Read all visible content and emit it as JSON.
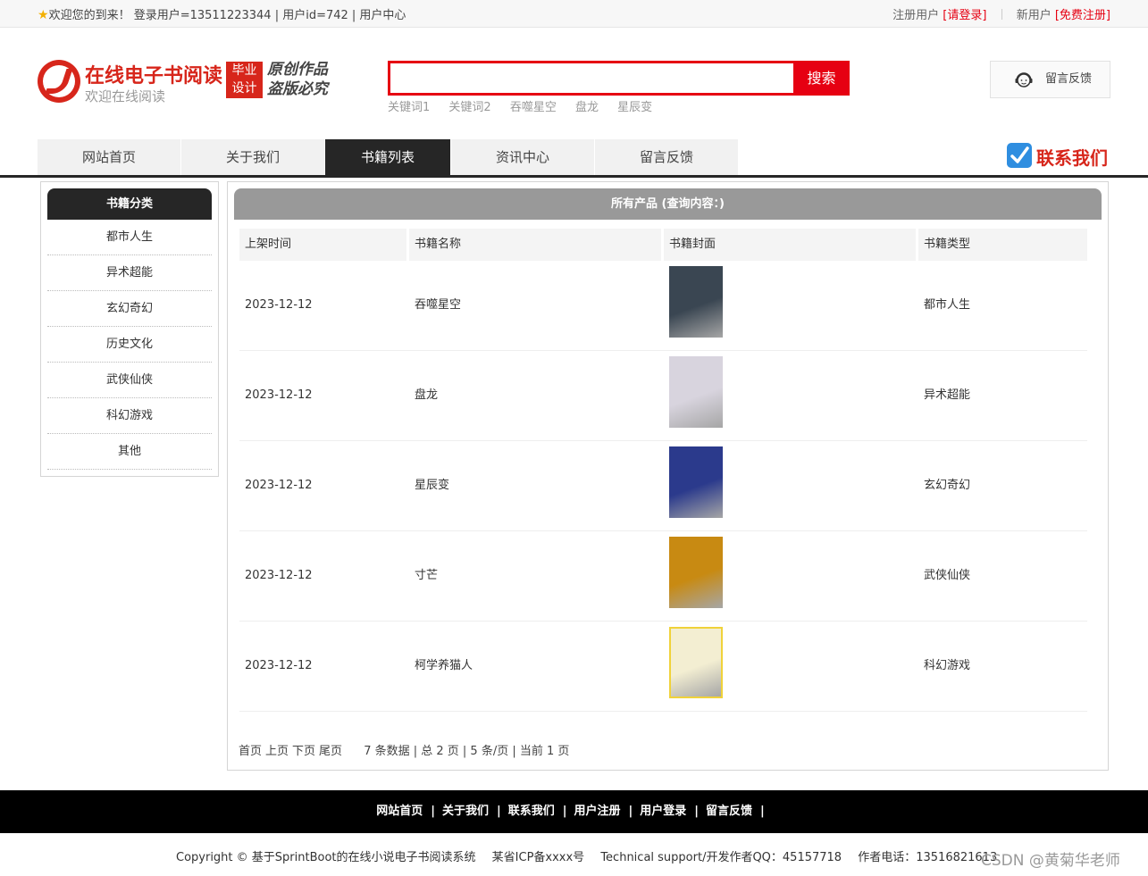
{
  "topbar": {
    "welcome": "欢迎您的到来！ 登录用户=13511223344 | 用户id=742 | 用户中心",
    "register_label": "注册用户",
    "login_link": "[请登录]",
    "newuser_label": "新用户",
    "free_register_link": "[免费注册]"
  },
  "header": {
    "title": "在线电子书阅读",
    "subtitle": "欢迎在线阅读",
    "grad_line1": "毕业",
    "grad_line2": "设计",
    "slogan_line1": "原创作品",
    "slogan_line2": "盗版必究",
    "search_button": "搜索",
    "search_value": "",
    "keywords": [
      "关键词1",
      "关键词2",
      "吞噬星空",
      "盘龙",
      "星辰变"
    ],
    "feedback_button": "留言反馈",
    "contact_label": "联系我们"
  },
  "nav": [
    "网站首页",
    "关于我们",
    "书籍列表",
    "资讯中心",
    "留言反馈"
  ],
  "nav_active": "书籍列表",
  "sidebar": {
    "title": "书籍分类",
    "categories": [
      "都市人生",
      "异术超能",
      "玄幻奇幻",
      "历史文化",
      "武侠仙侠",
      "科幻游戏",
      "其他"
    ]
  },
  "main": {
    "title": "所有产品 (查询内容：)",
    "columns": [
      "上架时间",
      "书籍名称",
      "书籍封面",
      "书籍类型"
    ],
    "rows": [
      {
        "date": "2023-12-12",
        "name": "吞噬星空",
        "type": "都市人生",
        "cover_color": "#3a4652"
      },
      {
        "date": "2023-12-12",
        "name": "盘龙",
        "type": "异术超能",
        "cover_color": "#d8d4de"
      },
      {
        "date": "2023-12-12",
        "name": "星辰变",
        "type": "玄幻奇幻",
        "cover_color": "#2b3a8c"
      },
      {
        "date": "2023-12-12",
        "name": "寸芒",
        "type": "武侠仙侠",
        "cover_color": "#c88a12"
      },
      {
        "date": "2023-12-12",
        "name": "柯学养猫人",
        "type": "科幻游戏",
        "cover_color": "#f3eed2"
      }
    ],
    "pager": {
      "first": "首页",
      "prev": "上页",
      "next": "下页",
      "last": "尾页",
      "summary": "7 条数据 | 总 2 页 | 5 条/页 | 当前 1 页"
    }
  },
  "footer": {
    "links": [
      "网站首页",
      "关于我们",
      "联系我们",
      "用户注册",
      "用户登录",
      "留言反馈"
    ],
    "copyright": "Copyright © 基于SprintBoot的在线小说电子书阅读系统",
    "icp": "某省ICP备xxxx号",
    "support": "Technical support/开发作者QQ：45157718",
    "phone": "作者电话：13516821613",
    "watermark": "CSDN @黄菊华老师"
  },
  "colors": {
    "brand_red": "#e60012",
    "dark": "#262626"
  }
}
